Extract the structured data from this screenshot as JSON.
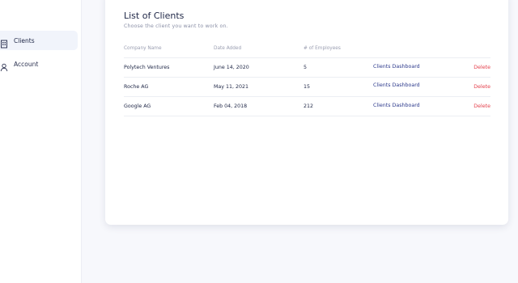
{
  "sidebar": {
    "items": [
      {
        "label": "Clients",
        "icon": "building-icon",
        "active": true
      },
      {
        "label": "Account",
        "icon": "user-icon",
        "active": false
      }
    ]
  },
  "main": {
    "title": "List of Clients",
    "subtitle": "Choose the client you want to work on.",
    "columns": [
      "Company Name",
      "Date Added",
      "# of Employees"
    ],
    "rows": [
      {
        "company": "Polytech Ventures",
        "date": "June 14, 2020",
        "employees": "5",
        "action": "Clients Dashboard",
        "delete": "Delete"
      },
      {
        "company": "Roche AG",
        "date": "May 11, 2021",
        "employees": "15",
        "action": "Clients Dashboard",
        "delete": "Delete"
      },
      {
        "company": "Google AG",
        "date": "Feb 04, 2018",
        "employees": "212",
        "action": "Clients Dashboard",
        "delete": "Delete"
      }
    ]
  },
  "colors": {
    "accent": "#2d3a8c",
    "danger": "#e4404c",
    "active_nav_bg": "#f1f4fb"
  }
}
